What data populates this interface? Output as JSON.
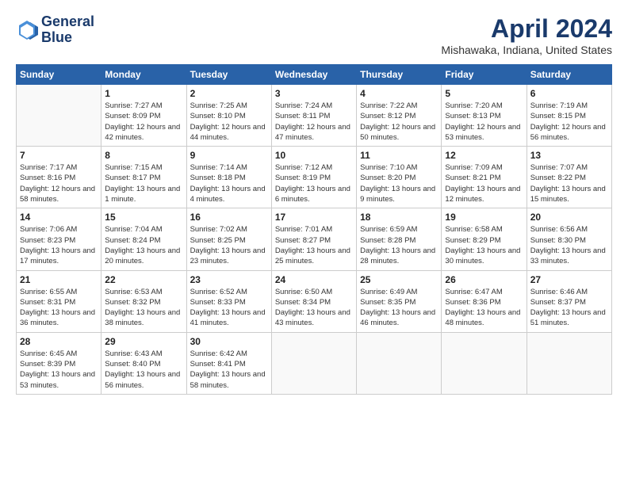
{
  "header": {
    "logo_line1": "General",
    "logo_line2": "Blue",
    "main_title": "April 2024",
    "subtitle": "Mishawaka, Indiana, United States"
  },
  "days_of_week": [
    "Sunday",
    "Monday",
    "Tuesday",
    "Wednesday",
    "Thursday",
    "Friday",
    "Saturday"
  ],
  "weeks": [
    [
      {
        "day": "",
        "sunrise": "",
        "sunset": "",
        "daylight": ""
      },
      {
        "day": "1",
        "sunrise": "Sunrise: 7:27 AM",
        "sunset": "Sunset: 8:09 PM",
        "daylight": "Daylight: 12 hours and 42 minutes."
      },
      {
        "day": "2",
        "sunrise": "Sunrise: 7:25 AM",
        "sunset": "Sunset: 8:10 PM",
        "daylight": "Daylight: 12 hours and 44 minutes."
      },
      {
        "day": "3",
        "sunrise": "Sunrise: 7:24 AM",
        "sunset": "Sunset: 8:11 PM",
        "daylight": "Daylight: 12 hours and 47 minutes."
      },
      {
        "day": "4",
        "sunrise": "Sunrise: 7:22 AM",
        "sunset": "Sunset: 8:12 PM",
        "daylight": "Daylight: 12 hours and 50 minutes."
      },
      {
        "day": "5",
        "sunrise": "Sunrise: 7:20 AM",
        "sunset": "Sunset: 8:13 PM",
        "daylight": "Daylight: 12 hours and 53 minutes."
      },
      {
        "day": "6",
        "sunrise": "Sunrise: 7:19 AM",
        "sunset": "Sunset: 8:15 PM",
        "daylight": "Daylight: 12 hours and 56 minutes."
      }
    ],
    [
      {
        "day": "7",
        "sunrise": "Sunrise: 7:17 AM",
        "sunset": "Sunset: 8:16 PM",
        "daylight": "Daylight: 12 hours and 58 minutes."
      },
      {
        "day": "8",
        "sunrise": "Sunrise: 7:15 AM",
        "sunset": "Sunset: 8:17 PM",
        "daylight": "Daylight: 13 hours and 1 minute."
      },
      {
        "day": "9",
        "sunrise": "Sunrise: 7:14 AM",
        "sunset": "Sunset: 8:18 PM",
        "daylight": "Daylight: 13 hours and 4 minutes."
      },
      {
        "day": "10",
        "sunrise": "Sunrise: 7:12 AM",
        "sunset": "Sunset: 8:19 PM",
        "daylight": "Daylight: 13 hours and 6 minutes."
      },
      {
        "day": "11",
        "sunrise": "Sunrise: 7:10 AM",
        "sunset": "Sunset: 8:20 PM",
        "daylight": "Daylight: 13 hours and 9 minutes."
      },
      {
        "day": "12",
        "sunrise": "Sunrise: 7:09 AM",
        "sunset": "Sunset: 8:21 PM",
        "daylight": "Daylight: 13 hours and 12 minutes."
      },
      {
        "day": "13",
        "sunrise": "Sunrise: 7:07 AM",
        "sunset": "Sunset: 8:22 PM",
        "daylight": "Daylight: 13 hours and 15 minutes."
      }
    ],
    [
      {
        "day": "14",
        "sunrise": "Sunrise: 7:06 AM",
        "sunset": "Sunset: 8:23 PM",
        "daylight": "Daylight: 13 hours and 17 minutes."
      },
      {
        "day": "15",
        "sunrise": "Sunrise: 7:04 AM",
        "sunset": "Sunset: 8:24 PM",
        "daylight": "Daylight: 13 hours and 20 minutes."
      },
      {
        "day": "16",
        "sunrise": "Sunrise: 7:02 AM",
        "sunset": "Sunset: 8:25 PM",
        "daylight": "Daylight: 13 hours and 23 minutes."
      },
      {
        "day": "17",
        "sunrise": "Sunrise: 7:01 AM",
        "sunset": "Sunset: 8:27 PM",
        "daylight": "Daylight: 13 hours and 25 minutes."
      },
      {
        "day": "18",
        "sunrise": "Sunrise: 6:59 AM",
        "sunset": "Sunset: 8:28 PM",
        "daylight": "Daylight: 13 hours and 28 minutes."
      },
      {
        "day": "19",
        "sunrise": "Sunrise: 6:58 AM",
        "sunset": "Sunset: 8:29 PM",
        "daylight": "Daylight: 13 hours and 30 minutes."
      },
      {
        "day": "20",
        "sunrise": "Sunrise: 6:56 AM",
        "sunset": "Sunset: 8:30 PM",
        "daylight": "Daylight: 13 hours and 33 minutes."
      }
    ],
    [
      {
        "day": "21",
        "sunrise": "Sunrise: 6:55 AM",
        "sunset": "Sunset: 8:31 PM",
        "daylight": "Daylight: 13 hours and 36 minutes."
      },
      {
        "day": "22",
        "sunrise": "Sunrise: 6:53 AM",
        "sunset": "Sunset: 8:32 PM",
        "daylight": "Daylight: 13 hours and 38 minutes."
      },
      {
        "day": "23",
        "sunrise": "Sunrise: 6:52 AM",
        "sunset": "Sunset: 8:33 PM",
        "daylight": "Daylight: 13 hours and 41 minutes."
      },
      {
        "day": "24",
        "sunrise": "Sunrise: 6:50 AM",
        "sunset": "Sunset: 8:34 PM",
        "daylight": "Daylight: 13 hours and 43 minutes."
      },
      {
        "day": "25",
        "sunrise": "Sunrise: 6:49 AM",
        "sunset": "Sunset: 8:35 PM",
        "daylight": "Daylight: 13 hours and 46 minutes."
      },
      {
        "day": "26",
        "sunrise": "Sunrise: 6:47 AM",
        "sunset": "Sunset: 8:36 PM",
        "daylight": "Daylight: 13 hours and 48 minutes."
      },
      {
        "day": "27",
        "sunrise": "Sunrise: 6:46 AM",
        "sunset": "Sunset: 8:37 PM",
        "daylight": "Daylight: 13 hours and 51 minutes."
      }
    ],
    [
      {
        "day": "28",
        "sunrise": "Sunrise: 6:45 AM",
        "sunset": "Sunset: 8:39 PM",
        "daylight": "Daylight: 13 hours and 53 minutes."
      },
      {
        "day": "29",
        "sunrise": "Sunrise: 6:43 AM",
        "sunset": "Sunset: 8:40 PM",
        "daylight": "Daylight: 13 hours and 56 minutes."
      },
      {
        "day": "30",
        "sunrise": "Sunrise: 6:42 AM",
        "sunset": "Sunset: 8:41 PM",
        "daylight": "Daylight: 13 hours and 58 minutes."
      },
      {
        "day": "",
        "sunrise": "",
        "sunset": "",
        "daylight": ""
      },
      {
        "day": "",
        "sunrise": "",
        "sunset": "",
        "daylight": ""
      },
      {
        "day": "",
        "sunrise": "",
        "sunset": "",
        "daylight": ""
      },
      {
        "day": "",
        "sunrise": "",
        "sunset": "",
        "daylight": ""
      }
    ]
  ]
}
